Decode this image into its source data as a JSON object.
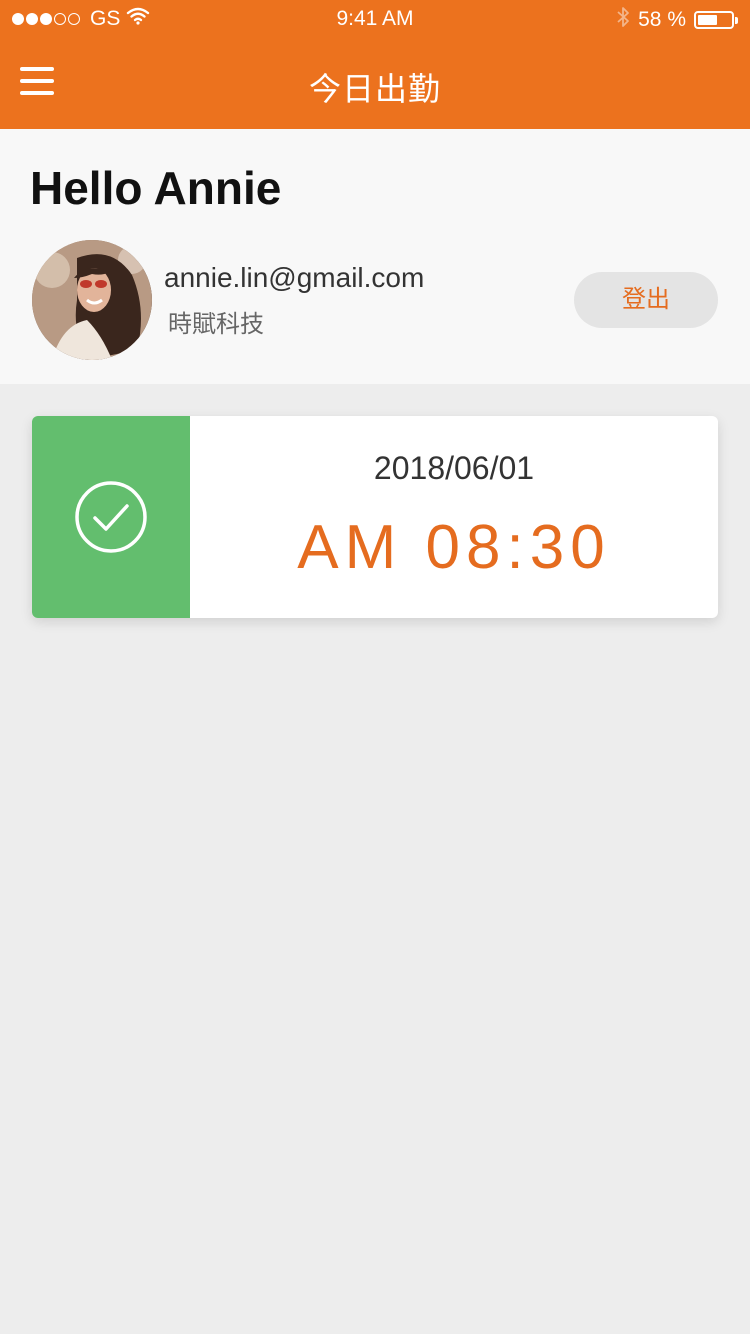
{
  "status_bar": {
    "signal_filled": 3,
    "signal_total": 5,
    "carrier": "GS",
    "time": "9:41 AM",
    "battery_percent": "58 %",
    "battery_level": 0.58,
    "icons": [
      "wifi-icon",
      "bluetooth-icon",
      "battery-icon"
    ]
  },
  "nav": {
    "title": "今日出勤",
    "menu_icon": "hamburger-menu-icon"
  },
  "profile": {
    "greeting": "Hello Annie",
    "email": "annie.lin@gmail.com",
    "company": "時賦科技",
    "logout_label": "登出"
  },
  "attendance": {
    "status_icon": "check-circle-icon",
    "date": "2018/06/01",
    "time": "AM 08:30"
  },
  "colors": {
    "brand": "#ec721e",
    "accent_text": "#e56c1f",
    "success": "#63be6e",
    "background": "#ededed"
  }
}
